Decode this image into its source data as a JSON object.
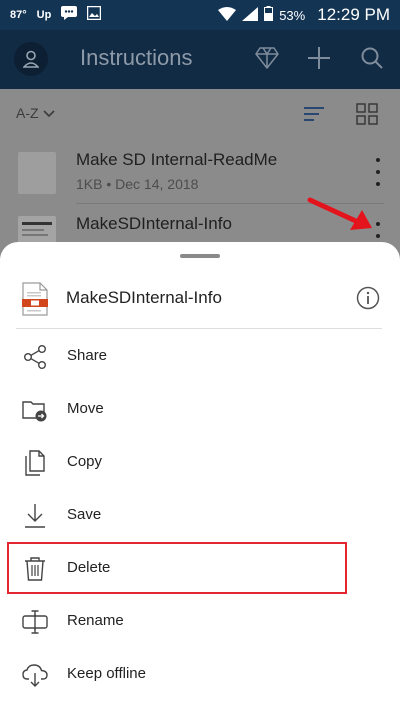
{
  "status_bar": {
    "temperature": "87°",
    "carrier_badge": "Up",
    "battery_percent": "53%",
    "time": "12:29 PM"
  },
  "app_bar": {
    "title": "Instructions",
    "icons": [
      "avatar-icon",
      "premium-diamond-icon",
      "add-icon",
      "search-icon"
    ]
  },
  "toolbar": {
    "sort_label": "A-Z",
    "icons": [
      "sort-chevron-icon",
      "list-view-icon",
      "grid-view-icon"
    ]
  },
  "files": [
    {
      "name": "Make SD Internal-ReadMe",
      "meta": "1KB • Dec 14, 2018"
    },
    {
      "name": "MakeSDInternal-Info",
      "meta": ""
    }
  ],
  "sheet": {
    "file_name": "MakeSDInternal-Info",
    "menu": [
      {
        "label": "Share",
        "icon": "share-icon"
      },
      {
        "label": "Move",
        "icon": "move-folder-icon"
      },
      {
        "label": "Copy",
        "icon": "copy-icon"
      },
      {
        "label": "Save",
        "icon": "download-icon"
      },
      {
        "label": "Delete",
        "icon": "trash-icon"
      },
      {
        "label": "Rename",
        "icon": "rename-icon"
      },
      {
        "label": "Keep offline",
        "icon": "cloud-download-icon"
      }
    ]
  },
  "colors": {
    "status_bar": "#143454",
    "app_bar": "#112b45",
    "highlight": "#e4262e",
    "pdf_accent": "#d2461e"
  }
}
